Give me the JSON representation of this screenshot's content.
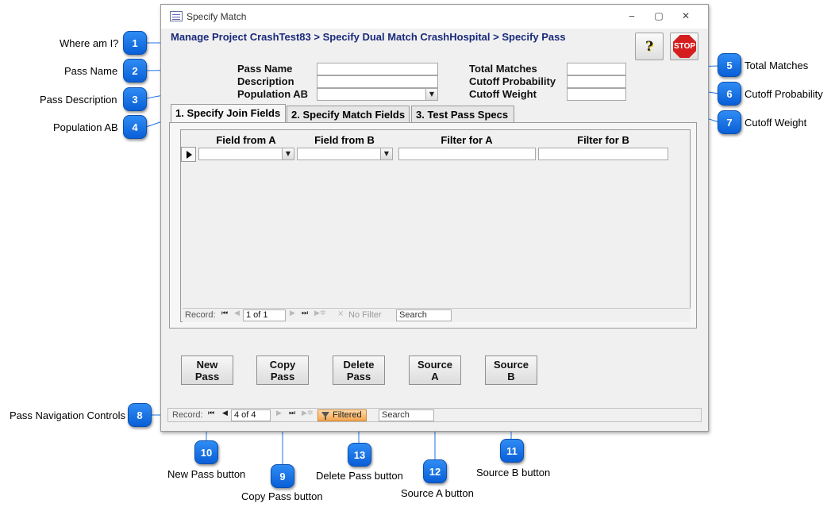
{
  "window": {
    "title": "Specify Match",
    "breadcrumb": "Manage Project CrashTest83 > Specify Dual Match CrashHospital > Specify Pass",
    "help_glyph": "?",
    "stop_label": "STOP"
  },
  "form": {
    "pass_name_label": "Pass Name",
    "description_label": "Description",
    "population_label": "Population AB",
    "total_matches_label": "Total Matches",
    "cutoff_probability_label": "Cutoff Probability",
    "cutoff_weight_label": "Cutoff Weight",
    "pass_name_value": "",
    "description_value": "",
    "population_value": "",
    "total_matches_value": "",
    "cutoff_probability_value": "",
    "cutoff_weight_value": ""
  },
  "tabs": [
    {
      "label": "1. Specify Join Fields",
      "active": true
    },
    {
      "label": "2. Specify Match Fields",
      "active": false
    },
    {
      "label": "3. Test Pass Specs",
      "active": false
    }
  ],
  "grid": {
    "columns": [
      "Field from A",
      "Field from B",
      "Filter for A",
      "Filter for B"
    ],
    "row": {
      "field_a": "",
      "field_b": "",
      "filter_a": "",
      "filter_b": ""
    }
  },
  "subform_nav": {
    "record_label": "Record:",
    "position": "1 of 1",
    "filter_label": "No Filter",
    "search_placeholder": "Search"
  },
  "buttons": {
    "new_pass": [
      "New",
      "Pass"
    ],
    "copy_pass": [
      "Copy",
      "Pass"
    ],
    "delete_pass": [
      "Delete",
      "Pass"
    ],
    "source_a": [
      "Source",
      "A"
    ],
    "source_b": [
      "Source",
      "B"
    ]
  },
  "main_nav": {
    "record_label": "Record:",
    "position": "4 of 4",
    "filter_label": "Filtered",
    "search_placeholder": "Search"
  },
  "callouts": [
    {
      "n": "1",
      "label": "Where am I?"
    },
    {
      "n": "2",
      "label": "Pass Name"
    },
    {
      "n": "3",
      "label": "Pass Description"
    },
    {
      "n": "4",
      "label": "Population AB"
    },
    {
      "n": "5",
      "label": "Total Matches"
    },
    {
      "n": "6",
      "label": "Cutoff Probability"
    },
    {
      "n": "7",
      "label": "Cutoff Weight"
    },
    {
      "n": "8",
      "label": "Pass Navigation Controls"
    },
    {
      "n": "9",
      "label": "Copy Pass button"
    },
    {
      "n": "10",
      "label": "New Pass button"
    },
    {
      "n": "11",
      "label": "Source B button"
    },
    {
      "n": "12",
      "label": "Source A button"
    },
    {
      "n": "13",
      "label": "Delete Pass button"
    }
  ],
  "colors": {
    "badge": "#1c74e6",
    "breadcrumb": "#1a2a7a",
    "stop": "#d41e1e",
    "filtered": "#f5a64e"
  }
}
